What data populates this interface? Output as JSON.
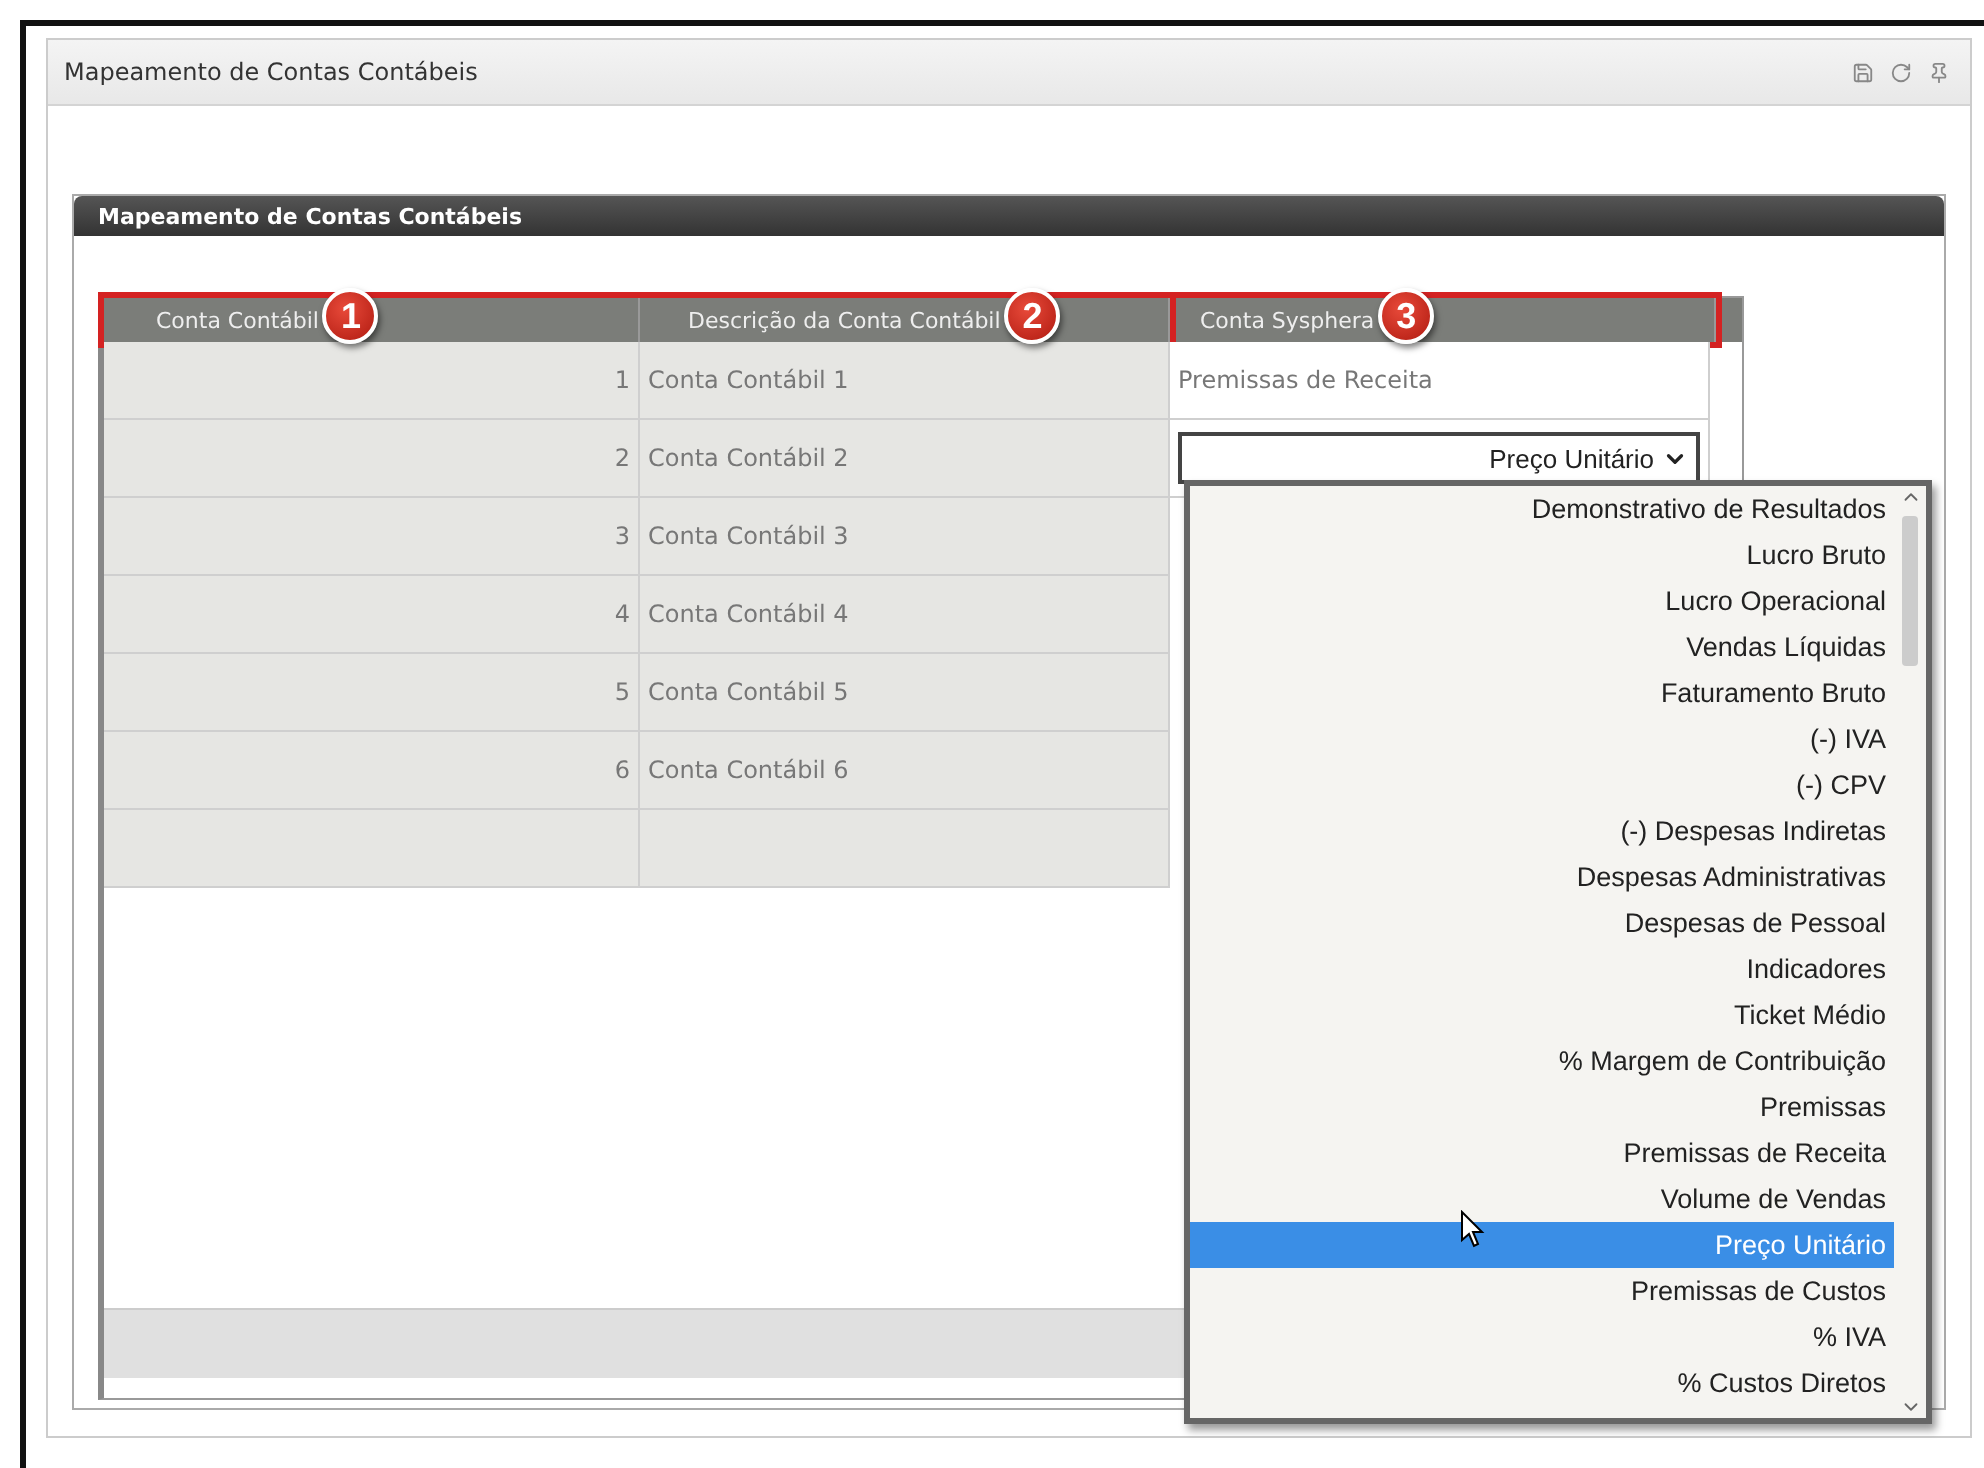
{
  "panel": {
    "title": "Mapeamento de Contas Contábeis"
  },
  "inner_panel": {
    "title": "Mapeamento de Contas Contábeis"
  },
  "table": {
    "columns": [
      "Conta Contábil",
      "Descrição da Conta Contábil",
      "Conta Sysphera"
    ],
    "rows": [
      {
        "number": "1",
        "description": "Conta Contábil 1",
        "sysphera": {
          "kind": "text",
          "text": "Premissas de Receita"
        }
      },
      {
        "number": "2",
        "description": "Conta Contábil 2",
        "sysphera": {
          "kind": "select",
          "value": "Preço Unitário"
        }
      },
      {
        "number": "3",
        "description": "Conta Contábil 3"
      },
      {
        "number": "4",
        "description": "Conta Contábil 4"
      },
      {
        "number": "5",
        "description": "Conta Contábil 5"
      },
      {
        "number": "6",
        "description": "Conta Contábil 6"
      }
    ]
  },
  "dropdown": {
    "options": [
      {
        "label": "Demonstrativo de Resultados",
        "selected": false
      },
      {
        "label": "Lucro Bruto",
        "selected": false
      },
      {
        "label": "Lucro Operacional",
        "selected": false
      },
      {
        "label": "Vendas Líquidas",
        "selected": false
      },
      {
        "label": "Faturamento Bruto",
        "selected": false
      },
      {
        "label": "(-) IVA",
        "selected": false
      },
      {
        "label": "(-) CPV",
        "selected": false
      },
      {
        "label": "(-) Despesas Indiretas",
        "selected": false
      },
      {
        "label": "Despesas Administrativas",
        "selected": false
      },
      {
        "label": "Despesas de Pessoal",
        "selected": false
      },
      {
        "label": "Indicadores",
        "selected": false
      },
      {
        "label": "Ticket Médio",
        "selected": false
      },
      {
        "label": "% Margem de Contribuição",
        "selected": false
      },
      {
        "label": "Premissas",
        "selected": false
      },
      {
        "label": "Premissas de Receita",
        "selected": false
      },
      {
        "label": "Volume de Vendas",
        "selected": false
      },
      {
        "label": "Preço Unitário",
        "selected": true
      },
      {
        "label": "Premissas de Custos",
        "selected": false
      },
      {
        "label": "% IVA",
        "selected": false
      },
      {
        "label": "% Custos Diretos",
        "selected": false
      }
    ]
  },
  "annotations": [
    "1",
    "2",
    "3"
  ]
}
